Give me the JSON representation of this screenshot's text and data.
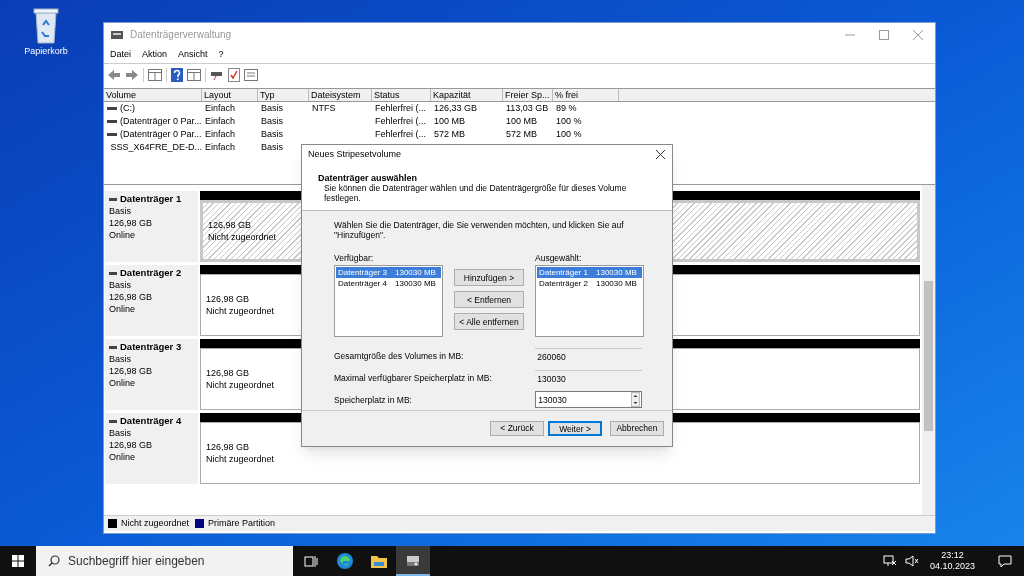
{
  "desktop": {
    "icons": [
      {
        "label": "Papierkorb"
      }
    ]
  },
  "window": {
    "title": "Datenträgerverwaltung",
    "menu": [
      "Datei",
      "Aktion",
      "Ansicht",
      "?"
    ],
    "volume_table": {
      "columns": [
        "Volume",
        "Layout",
        "Typ",
        "Dateisystem",
        "Status",
        "Kapazität",
        "Freier Sp...",
        "% frei"
      ],
      "rows": [
        [
          "(C:)",
          "Einfach",
          "Basis",
          "NTFS",
          "Fehlerfrei (...",
          "126,33 GB",
          "113,03 GB",
          "89 %"
        ],
        [
          "(Datenträger 0 Par...",
          "Einfach",
          "Basis",
          "",
          "Fehlerfrei (...",
          "100 MB",
          "100 MB",
          "100 %"
        ],
        [
          "(Datenträger 0 Par...",
          "Einfach",
          "Basis",
          "",
          "Fehlerfrei (...",
          "572 MB",
          "572 MB",
          "100 %"
        ],
        [
          "SSS_X64FRE_DE-D...",
          "Einfach",
          "Basis"
        ]
      ]
    },
    "disks": [
      {
        "name": "Datenträger 1",
        "type": "Basis",
        "size": "126,98 GB",
        "state": "Online",
        "partition": {
          "size": "126,98 GB",
          "status": "Nicht zugeordnet",
          "selected": true
        }
      },
      {
        "name": "Datenträger 2",
        "type": "Basis",
        "size": "126,98 GB",
        "state": "Online",
        "partition": {
          "size": "126,98 GB",
          "status": "Nicht zugeordnet",
          "selected": false
        }
      },
      {
        "name": "Datenträger 3",
        "type": "Basis",
        "size": "126,98 GB",
        "state": "Online",
        "partition": {
          "size": "126,98 GB",
          "status": "Nicht zugeordnet",
          "selected": false
        }
      },
      {
        "name": "Datenträger 4",
        "type": "Basis",
        "size": "126,98 GB",
        "state": "Online",
        "partition": {
          "size": "126,98 GB",
          "status": "Nicht zugeordnet",
          "selected": false
        }
      }
    ],
    "legend": [
      {
        "label": "Nicht zugeordnet",
        "color": "#000000"
      },
      {
        "label": "Primäre Partition",
        "color": "#000080"
      }
    ]
  },
  "dialog": {
    "title": "Neues Stripesetvolume",
    "heading": "Datenträger auswählen",
    "subheading": "Sie können die Datenträger wählen und die Datenträgergröße für dieses Volume festlegen.",
    "instruction": "Wählen Sie die Datenträger, die Sie verwenden möchten, und klicken Sie auf \"Hinzufügen\".",
    "available": {
      "label": "Verfügbar:",
      "items": [
        {
          "name": "Datenträger 3",
          "size": "130030 MB",
          "selected": true
        },
        {
          "name": "Datenträger 4",
          "size": "130030 MB",
          "selected": false
        }
      ]
    },
    "move_buttons": [
      "Hinzufügen >",
      "< Entfernen",
      "< Alle entfernen"
    ],
    "selected_list": {
      "label": "Ausgewählt:",
      "items": [
        {
          "name": "Datenträger 1",
          "size": "130030 MB",
          "selected": true
        },
        {
          "name": "Datenträger 2",
          "size": "130030 MB",
          "selected": false
        }
      ]
    },
    "fields": [
      {
        "kind": "readonly",
        "label": "Gesamtgröße des Volumes in MB:",
        "value": "260060"
      },
      {
        "kind": "readonly",
        "label": "Maximal verfügbarer Speicherplatz in MB:",
        "value": "130030"
      },
      {
        "kind": "spin",
        "label": "Speicherplatz in MB:",
        "value": "130030"
      }
    ],
    "buttons": [
      {
        "label": "< Zurück",
        "default": false
      },
      {
        "label": "Weiter >",
        "default": true
      },
      {
        "label": "Abbrechen",
        "default": false
      }
    ]
  },
  "taskbar": {
    "search": {
      "placeholder": "Suchbegriff hier eingeben"
    },
    "time": "23:12",
    "date": "04.10.2023"
  }
}
